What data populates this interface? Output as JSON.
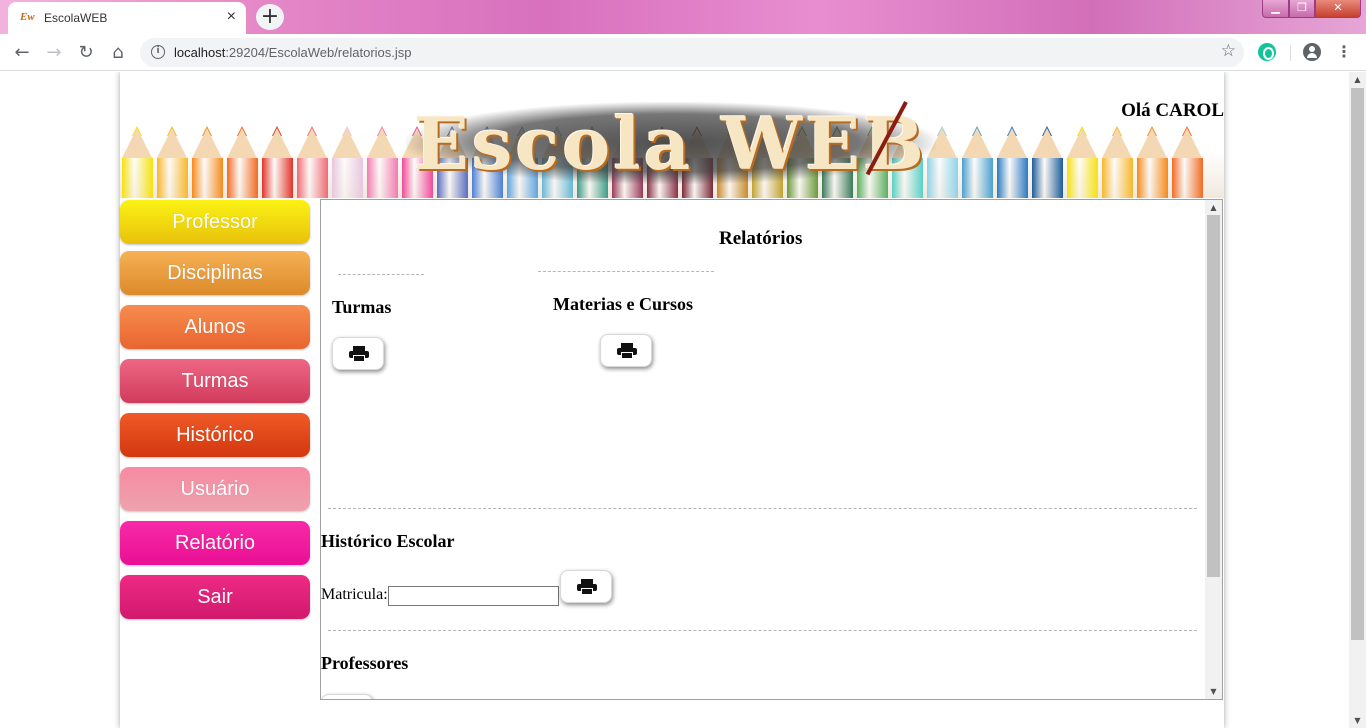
{
  "browser": {
    "tab_title": "EscolaWEB",
    "tab_favicon": "Ew",
    "tab_close": "×",
    "new_tab": "+",
    "url_host": "localhost",
    "url_path": ":29204/EscolaWeb/relatorios.jsp",
    "window_controls": {
      "minimize": "▁",
      "maximize": "❐",
      "close": "✕"
    },
    "icons": [
      "back-icon",
      "forward-icon",
      "reload-icon",
      "home-icon",
      "info-icon",
      "star-icon",
      "grammarly-icon",
      "account-icon",
      "menu-icon"
    ]
  },
  "header": {
    "logo_text": "Escola WEB",
    "greeting": "Olá CAROL"
  },
  "sidebar": {
    "items": [
      {
        "label": "Professor",
        "color_top": "#fbf215",
        "color_bottom": "#e8c10b"
      },
      {
        "label": "Disciplinas",
        "color_top": "#f6b156",
        "color_bottom": "#dc8a2a"
      },
      {
        "label": "Alunos",
        "color_top": "#f78d4e",
        "color_bottom": "#e8652f"
      },
      {
        "label": "Turmas",
        "color_top": "#ed6884",
        "color_bottom": "#d23a5c"
      },
      {
        "label": "Histórico",
        "color_top": "#ef5a26",
        "color_bottom": "#d3370f"
      },
      {
        "label": "Usuário",
        "color_top": "#f78aa1",
        "color_bottom": "#eda2ae"
      },
      {
        "label": "Relatório",
        "color_top": "#f72ba8",
        "color_bottom": "#ea0e95"
      },
      {
        "label": "Sair",
        "color_top": "#ee2a85",
        "color_bottom": "#d1196e"
      }
    ]
  },
  "content": {
    "title": "Relatórios",
    "turmas": {
      "heading": "Turmas"
    },
    "materias": {
      "heading": "Materias e Cursos"
    },
    "historico": {
      "heading": "Histórico Escolar",
      "matricula_label": "Matricula:",
      "matricula_value": ""
    },
    "professores": {
      "heading": "Professores"
    }
  }
}
